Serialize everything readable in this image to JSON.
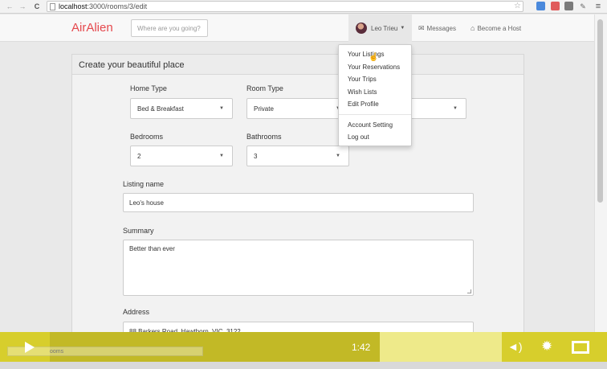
{
  "browser": {
    "url_host": "localhost",
    "url_path": ":3000/rooms/3/edit"
  },
  "navbar": {
    "brand": "AirAlien",
    "search_placeholder": "Where are you going?",
    "user_name": "Leo Trieu",
    "messages": "Messages",
    "become_host": "Become a Host"
  },
  "panel": {
    "title": "Create your beautiful place"
  },
  "form": {
    "home_type_label": "Home Type",
    "home_type_value": "Bed & Breakfast",
    "room_type_label": "Room Type",
    "room_type_value": "Private",
    "bedrooms_label": "Bedrooms",
    "bedrooms_value": "2",
    "bathrooms_label": "Bathrooms",
    "bathrooms_value": "3",
    "listing_name_label": "Listing name",
    "listing_name_value": "Leo's house",
    "summary_label": "Summary",
    "summary_value": "Better than ever",
    "address_label": "Address",
    "address_value": "88 Barkers Road, Hawthorn, VIC, 3122"
  },
  "user_menu": {
    "items": [
      "Your Listings",
      "Your Reservations",
      "Your Trips",
      "Wish Lists",
      "Edit Profile"
    ],
    "items_after_divider": [
      "Account Setting",
      "Log out"
    ]
  },
  "video": {
    "time": "1:42",
    "status_tip": "ooms",
    "progress_fraction": 0.73,
    "buffered_fraction": 1.0
  },
  "colors": {
    "brand": "#e5484d",
    "video_bar": "#d7ce2c"
  }
}
